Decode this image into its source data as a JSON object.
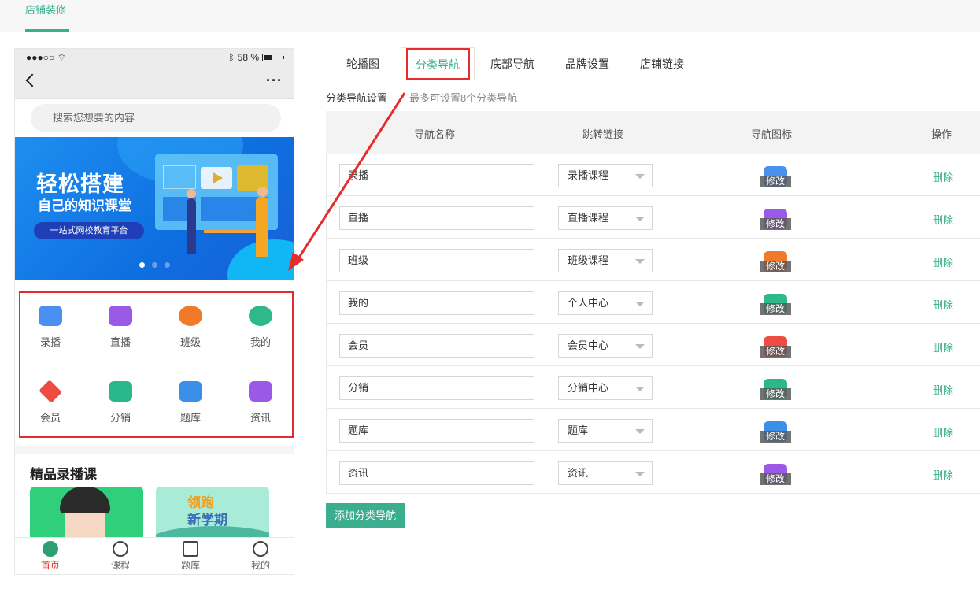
{
  "top": {
    "tab_label": "店铺装修"
  },
  "phone": {
    "status": {
      "signal": "●●●○○",
      "battery": "58 %"
    },
    "search_placeholder": "搜索您想要的内容",
    "banner": {
      "title": "轻松搭建",
      "subtitle": "自己的知识课堂",
      "pill": "一站式网校教育平台"
    },
    "categories": [
      {
        "label": "录播",
        "icon": "video-camera-icon",
        "color": "#4a90f0"
      },
      {
        "label": "直播",
        "icon": "tv-play-icon",
        "color": "#9b59e8"
      },
      {
        "label": "班级",
        "icon": "planet-icon",
        "color": "#f07a2a"
      },
      {
        "label": "我的",
        "icon": "bear-face-icon",
        "color": "#2fb88c"
      },
      {
        "label": "会员",
        "icon": "diamond-icon",
        "color": "#ee4b43"
      },
      {
        "label": "分销",
        "icon": "tag-icon",
        "color": "#29b889"
      },
      {
        "label": "题库",
        "icon": "book-icon",
        "color": "#3b8fe8"
      },
      {
        "label": "资讯",
        "icon": "news-icon",
        "color": "#9b59e8"
      }
    ],
    "section_title": "精品录播课",
    "course2": {
      "line1": "领跑",
      "line2": "新学期"
    },
    "tabbar": [
      {
        "label": "首页",
        "icon": "home-icon"
      },
      {
        "label": "课程",
        "icon": "diamond-outline-icon"
      },
      {
        "label": "题库",
        "icon": "clipboard-icon"
      },
      {
        "label": "我的",
        "icon": "smile-icon"
      }
    ]
  },
  "tabs": [
    {
      "label": "轮播图"
    },
    {
      "label": "分类导航"
    },
    {
      "label": "底部导航"
    },
    {
      "label": "品牌设置"
    },
    {
      "label": "店铺链接"
    }
  ],
  "settings": {
    "title": "分类导航设置",
    "hint": "最多可设置8个分类导航"
  },
  "table": {
    "headers": {
      "name": "导航名称",
      "link": "跳转链接",
      "icon": "导航图标",
      "action": "操作"
    },
    "edit_label": "修改",
    "delete_label": "删除",
    "rows": [
      {
        "name": "录播",
        "link": "录播课程",
        "color": "#4a90f0"
      },
      {
        "name": "直播",
        "link": "直播课程",
        "color": "#9b59e8"
      },
      {
        "name": "班级",
        "link": "班级课程",
        "color": "#f07a2a"
      },
      {
        "name": "我的",
        "link": "个人中心",
        "color": "#2fb88c"
      },
      {
        "name": "会员",
        "link": "会员中心",
        "color": "#ee4b43"
      },
      {
        "name": "分销",
        "link": "分销中心",
        "color": "#29b889"
      },
      {
        "name": "题库",
        "link": "题库",
        "color": "#3b8fe8"
      },
      {
        "name": "资讯",
        "link": "资讯",
        "color": "#9b59e8"
      }
    ]
  },
  "add_button": "添加分类导航",
  "colors": {
    "accent": "#3aae8e",
    "highlight": "#e52b2b"
  }
}
